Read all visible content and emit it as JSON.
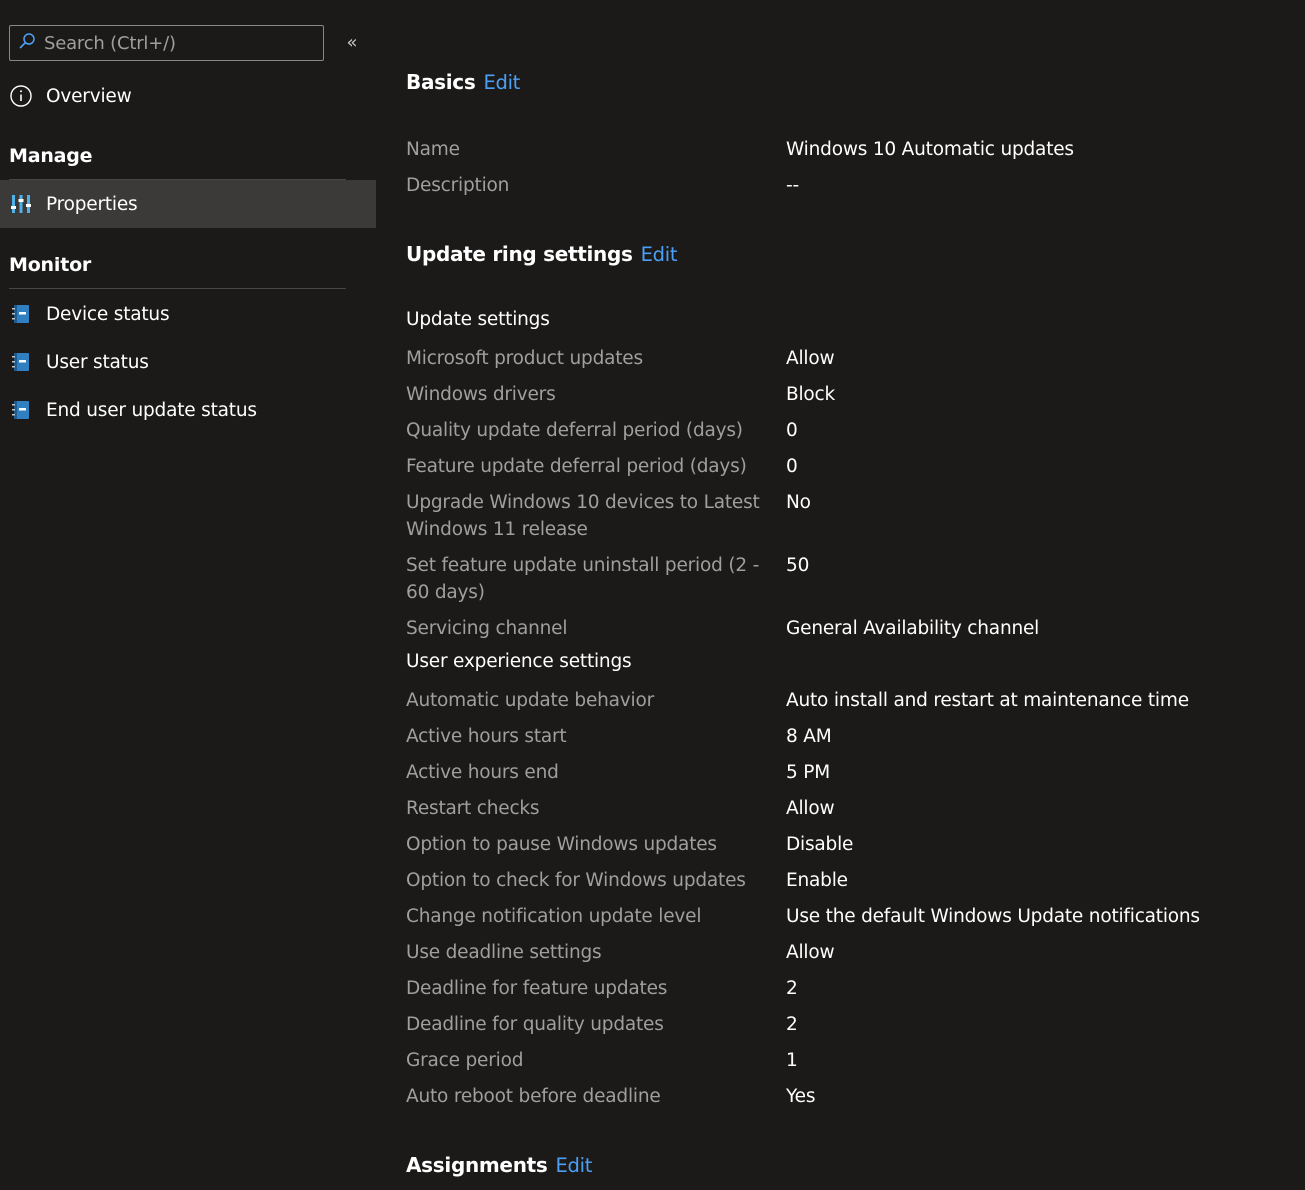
{
  "sidebar": {
    "search_placeholder": "Search (Ctrl+/)",
    "collapse_glyph": "«",
    "overview": "Overview",
    "manage_header": "Manage",
    "properties": "Properties",
    "monitor_header": "Monitor",
    "device_status": "Device status",
    "user_status": "User status",
    "end_user_status": "End user update status"
  },
  "main": {
    "basics": {
      "title": "Basics",
      "edit": "Edit"
    },
    "basics_rows": [
      {
        "label": "Name",
        "value": "Windows 10 Automatic updates"
      },
      {
        "label": "Description",
        "value": "--"
      }
    ],
    "ring": {
      "title": "Update ring settings",
      "edit": "Edit"
    },
    "update_settings_header": "Update settings",
    "update_rows": [
      {
        "label": "Microsoft product updates",
        "value": "Allow"
      },
      {
        "label": "Windows drivers",
        "value": "Block"
      },
      {
        "label": "Quality update deferral period (days)",
        "value": "0"
      },
      {
        "label": "Feature update deferral period (days)",
        "value": "0"
      },
      {
        "label": "Upgrade Windows 10 devices to Latest Windows 11 release",
        "value": "No"
      },
      {
        "label": "Set feature update uninstall period (2 - 60 days)",
        "value": "50"
      },
      {
        "label": "Servicing channel",
        "value": "General Availability channel"
      }
    ],
    "ux_header": "User experience settings",
    "ux_rows": [
      {
        "label": "Automatic update behavior",
        "value": "Auto install and restart at maintenance time"
      },
      {
        "label": "Active hours start",
        "value": "8 AM"
      },
      {
        "label": "Active hours end",
        "value": "5 PM"
      },
      {
        "label": "Restart checks",
        "value": "Allow"
      },
      {
        "label": "Option to pause Windows updates",
        "value": "Disable"
      },
      {
        "label": "Option to check for Windows updates",
        "value": "Enable"
      },
      {
        "label": "Change notification update level",
        "value": "Use the default Windows Update notifications"
      },
      {
        "label": "Use deadline settings",
        "value": "Allow"
      },
      {
        "label": "Deadline for feature updates",
        "value": "2"
      },
      {
        "label": "Deadline for quality updates",
        "value": "2"
      },
      {
        "label": "Grace period",
        "value": "1"
      },
      {
        "label": "Auto reboot before deadline",
        "value": "Yes"
      }
    ],
    "assignments": {
      "title": "Assignments",
      "edit": "Edit"
    }
  },
  "colors": {
    "background": "#1b1a19",
    "link": "#4ba0f5",
    "label": "#a19f9d",
    "selected": "#3b3a39",
    "icon_blue": "#50b0e8"
  }
}
